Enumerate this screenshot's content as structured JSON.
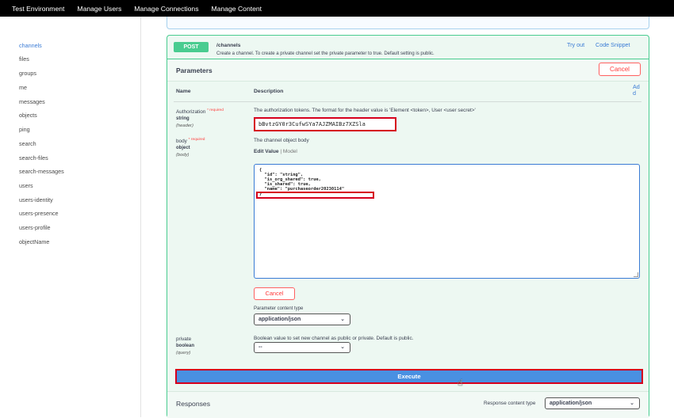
{
  "nav": [
    "Test Environment",
    "Manage Users",
    "Manage Connections",
    "Manage Content"
  ],
  "sidebar": {
    "active": "channels",
    "items": [
      "channels",
      "files",
      "groups",
      "me",
      "messages",
      "objects",
      "ping",
      "search",
      "search-files",
      "search-messages",
      "users",
      "users-identity",
      "users-presence",
      "users-profile",
      "objectName"
    ]
  },
  "operation": {
    "method": "POST",
    "path": "/channels",
    "summary": "Create a channel. To create a private channel set the private parameter to true. Default setting is public.",
    "try_out": "Try out",
    "code_snippet": "Code Snippet"
  },
  "parameters": {
    "title": "Parameters",
    "cancel": "Cancel",
    "col_name": "Name",
    "col_description": "Description",
    "add": "Ad d",
    "required": "* required",
    "authorization": {
      "name": "Authorization",
      "type": "string",
      "location": "(header)",
      "description": "The authorization tokens. The format for the header value is 'Element <token>, User <user secret>'",
      "value": "bBvtzGY0r3CufwSYa7AJZMAIBz7XZSla"
    },
    "body": {
      "name": "body",
      "type": "object",
      "location": "(body)",
      "description": "The channel object body",
      "tab_edit": "Edit Value",
      "tab_sep": " | ",
      "tab_model": "Model",
      "code": [
        "{",
        "  \"id\": \"string\",",
        "  \"is_org_shared\": true,",
        "  \"is_shared\": true,",
        "  \"name\": \"purchaseorder20230114\"",
        "}"
      ],
      "cancel": "Cancel",
      "content_type_label": "Parameter content type",
      "content_type": "application/json"
    },
    "private": {
      "name": "private",
      "type": "boolean",
      "location": "(query)",
      "description": "Boolean value to set new channel as public or private. Default is public.",
      "value": "--"
    }
  },
  "execute": "Execute",
  "responses": {
    "title": "Responses",
    "content_type_label": "Response content type",
    "content_type": "application/json"
  },
  "icons": {
    "chevron": "⌄",
    "cursor": "☝"
  }
}
